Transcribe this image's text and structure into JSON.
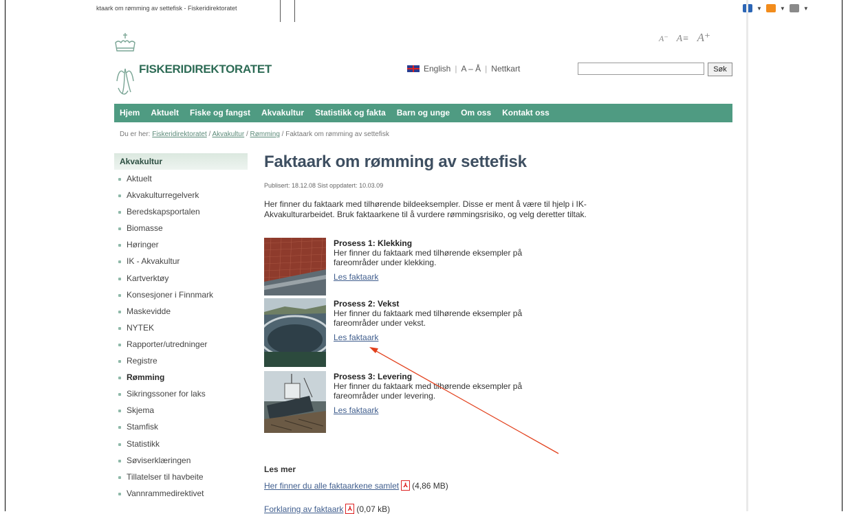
{
  "browser": {
    "tab_title": "ktaark om rømming av settefisk - Fiskeridirektoratet"
  },
  "site": {
    "logo_text": "FISKERIDIREKTORATET",
    "font_tools": {
      "small": "A⁻",
      "reset": "A≡",
      "large": "A⁺"
    },
    "top_links": {
      "english": "English",
      "aa": "A – Å",
      "sitemap": "Nettkart"
    },
    "search": {
      "value": "",
      "button": "Søk"
    }
  },
  "nav": {
    "items": [
      "Hjem",
      "Aktuelt",
      "Fiske og fangst",
      "Akvakultur",
      "Statistikk og fakta",
      "Barn og unge",
      "Om oss",
      "Kontakt oss"
    ],
    "color": "#4f9b82"
  },
  "breadcrumb": {
    "prefix": "Du er her:",
    "crumbs": [
      "Fiskeridirektoratet",
      "Akvakultur",
      "Rømming"
    ],
    "sep": "/",
    "current": "Faktaark om rømming av settefisk"
  },
  "sidebar": {
    "heading": "Akvakultur",
    "items": [
      "Aktuelt",
      "Akvakulturregelverk",
      "Beredskapsportalen",
      "Biomasse",
      "Høringer",
      "IK - Akvakultur",
      "Kartverktøy",
      "Konsesjoner i Finnmark",
      "Maskevidde",
      "NYTEK",
      "Rapporter/utredninger",
      "Registre",
      "Rømming",
      "Sikringssoner for laks",
      "Skjema",
      "Stamfisk",
      "Statistikk",
      "Søviserklæringen",
      "Tillatelser til havbeite",
      "Vannrammedirektivet"
    ],
    "active_index": 12
  },
  "main": {
    "title": "Faktaark om rømming av settefisk",
    "meta": "Publisert: 18.12.08   Sist oppdatert: 10.03.09",
    "intro": "Her finner du faktaark med tilhørende bildeeksempler. Disse er ment å være til hjelp i IK-Akvakulturarbeidet. Bruk faktaarkene til å vurdere rømmingsrisiko, og velg deretter tiltak.",
    "processes": [
      {
        "title": "Prosess 1: Klekking",
        "desc": "Her finner du faktaark med tilhørende eksempler på fareområder under klekking.",
        "link": "Les faktaark"
      },
      {
        "title": "Prosess 2: Vekst",
        "desc": "Her finner du faktaark med tilhørende eksempler på fareområder under vekst.",
        "link": "Les faktaark"
      },
      {
        "title": "Prosess 3: Levering",
        "desc": "Her finner du faktaark med tilhørende eksempler på fareområder under levering.",
        "link": "Les faktaark"
      }
    ],
    "les_mer": "Les mer",
    "downloads": [
      {
        "label": "Her finner du alle faktaarkene samlet",
        "size": "(4,86 MB)"
      },
      {
        "label": "Forklaring av faktaark",
        "size": "(0,07 kB)"
      }
    ]
  },
  "annotation": {
    "color": "#e2401c"
  }
}
